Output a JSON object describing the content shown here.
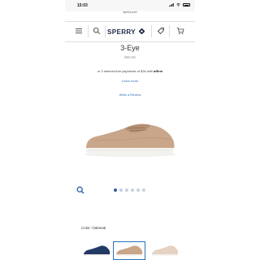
{
  "status": {
    "time": "15:03",
    "url": "sperry.com"
  },
  "header": {
    "brand": "SPERRY"
  },
  "product": {
    "name": "3-Eye",
    "price": "$99.95",
    "affirm_text": "or 3 interest-free payments of $34 with",
    "affirm_brand": "affirm",
    "learn_more": "Learn more",
    "write_review": "Write a Review",
    "color_label": "Color: Oatmeal"
  },
  "gallery": {
    "dot_count": 6,
    "active_index": 0
  },
  "swatches": [
    {
      "name": "navy",
      "color": "#243a66",
      "selected": false
    },
    {
      "name": "oatmeal",
      "color": "#c9a689",
      "selected": true
    },
    {
      "name": "light",
      "color": "#e6d2c2",
      "selected": false
    }
  ]
}
